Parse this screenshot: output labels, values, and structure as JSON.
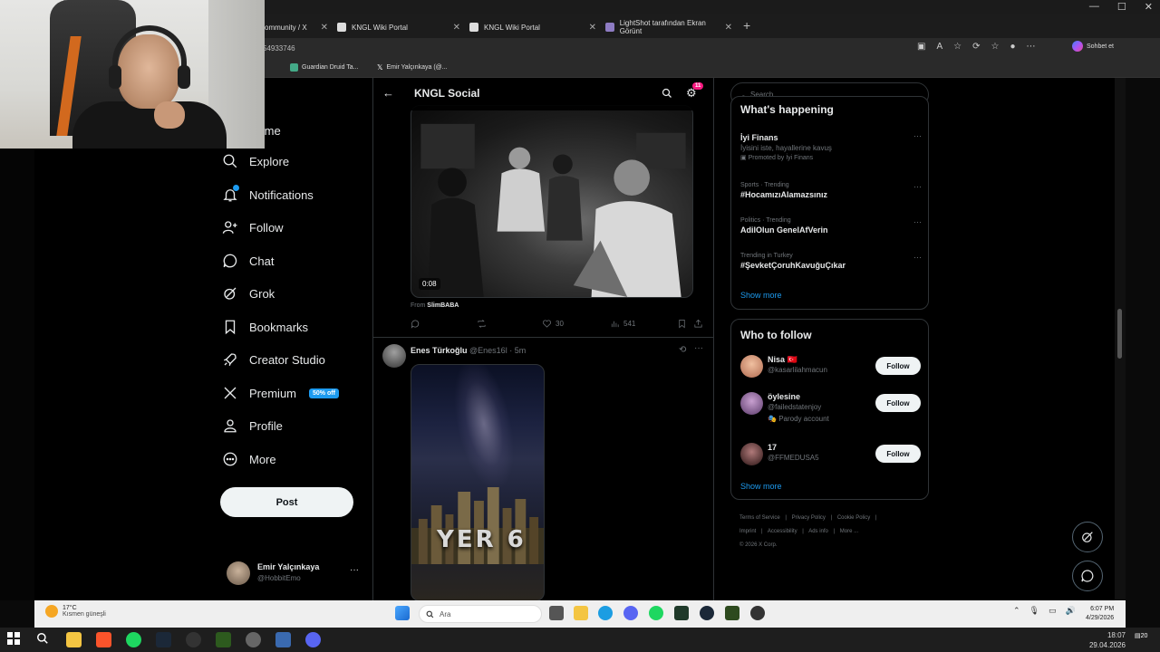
{
  "browser": {
    "tabs": [
      {
        "label": "ommunity / X"
      },
      {
        "label": "KNGL Wiki Portal"
      },
      {
        "label": "KNGL Wiki Portal"
      },
      {
        "label": "LightShot tarafından Ekran Görünt"
      }
    ],
    "url": "54933746",
    "bookmarks": [
      "Guardian Druid Ta...",
      "Emir Yalçınkaya (@..."
    ],
    "copilot_label": "Sohbet et"
  },
  "nav": {
    "items": [
      {
        "label": "Home"
      },
      {
        "label": "Explore"
      },
      {
        "label": "Notifications"
      },
      {
        "label": "Follow"
      },
      {
        "label": "Chat"
      },
      {
        "label": "Grok"
      },
      {
        "label": "Bookmarks"
      },
      {
        "label": "Creator Studio"
      },
      {
        "label": "Premium"
      },
      {
        "label": "Profile"
      },
      {
        "label": "More"
      }
    ],
    "premium_badge": "50% off",
    "post_label": "Post",
    "account": {
      "name": "Emir Yalçınkaya",
      "handle": "@HobbitEmo"
    }
  },
  "header": {
    "title": "KNGL Social",
    "notif_count": "11"
  },
  "tweet1": {
    "video_time": "0:08",
    "from_prefix": "From",
    "from_user": "SlimBABA",
    "likes": "30",
    "views": "541"
  },
  "tweet2": {
    "name": "Enes Türkoğlu",
    "handle": "@Enes16l",
    "time": "· 5m",
    "image_text": "YER 6"
  },
  "right": {
    "search_placeholder": "Search",
    "whats_happening": "What's happening",
    "trends": [
      {
        "meta": "",
        "title": "İyi Finans",
        "sub": "İyisini iste, hayallerine kavuş",
        "promo": "Promoted by İyi Finans"
      },
      {
        "meta": "Sports · Trending",
        "title": "#HocamızıAlamazsınız",
        "sub": "",
        "promo": ""
      },
      {
        "meta": "Politics · Trending",
        "title": "AdilOlun GenelAfVerin",
        "sub": "",
        "promo": ""
      },
      {
        "meta": "Trending in Turkey",
        "title": "#ŞevketÇoruhKavuğuÇıkar",
        "sub": "",
        "promo": ""
      }
    ],
    "show_more": "Show more",
    "who_to_follow": "Who to follow",
    "suggestions": [
      {
        "name": "Nisa 🇹🇷",
        "handle": "@kasarlilahmacun",
        "extra": ""
      },
      {
        "name": "öylesine",
        "handle": "@failedstatenjoy",
        "extra": "Parody account"
      },
      {
        "name": "17",
        "handle": "@FFMEDUSA5",
        "extra": ""
      }
    ],
    "follow_label": "Follow",
    "footer": [
      "Terms of Service",
      "|",
      "Privacy Policy",
      "|",
      "Cookie Policy",
      "|",
      "Imprint",
      "|",
      "Accessibility",
      "|",
      "Ads info",
      "|",
      "More ...",
      "© 2026 X Corp."
    ]
  },
  "inner_taskbar": {
    "temp": "17°C",
    "weather": "Kısmen güneşli",
    "search_placeholder": "Ara",
    "time": "6:07 PM",
    "date": "4/29/2026"
  },
  "outer_taskbar": {
    "time": "18:07",
    "date": "29.04.2026",
    "notif": "20"
  }
}
